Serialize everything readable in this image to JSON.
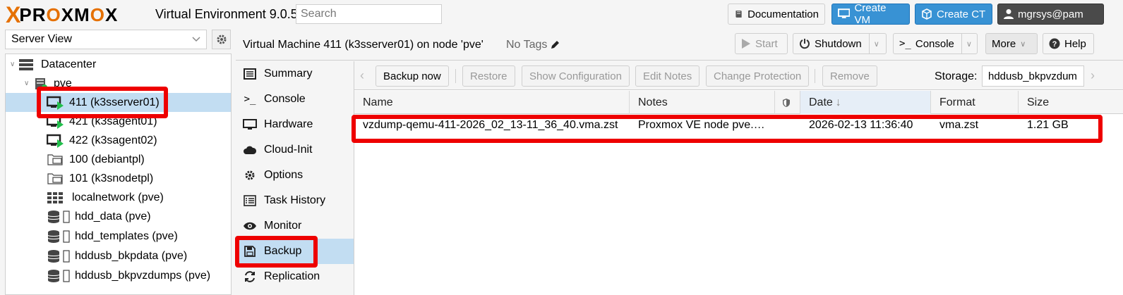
{
  "header": {
    "logo_text": "PROXMOX",
    "product": "Virtual Environment 9.0.5",
    "search_placeholder": "Search",
    "documentation_label": "Documentation",
    "create_vm_label": "Create VM",
    "create_ct_label": "Create CT",
    "user_label": "mgrsys@pam"
  },
  "left": {
    "view_select": "Server View",
    "tree": [
      {
        "label": "Datacenter",
        "icon": "datacenter-icon"
      },
      {
        "label": "pve",
        "icon": "node-icon"
      },
      {
        "label": "411 (k3sserver01)",
        "icon": "vm-running-icon",
        "selected": true
      },
      {
        "label": "421 (k3sagent01)",
        "icon": "vm-running-icon"
      },
      {
        "label": "422 (k3sagent02)",
        "icon": "vm-running-icon"
      },
      {
        "label": "100 (debiantpl)",
        "icon": "template-icon"
      },
      {
        "label": "101 (k3snodetpl)",
        "icon": "template-icon"
      },
      {
        "label": "localnetwork (pve)",
        "icon": "network-icon"
      },
      {
        "label": "hdd_data (pve)",
        "icon": "storage-icon"
      },
      {
        "label": "hdd_templates (pve)",
        "icon": "storage-icon"
      },
      {
        "label": "hddusb_bkpdata (pve)",
        "icon": "storage-icon"
      },
      {
        "label": "hddusb_bkpvzdumps (pve)",
        "icon": "storage-icon"
      }
    ]
  },
  "content": {
    "title": "Virtual Machine 411 (k3sserver01) on node 'pve'",
    "tags": "No Tags",
    "buttons": {
      "start": "Start",
      "shutdown": "Shutdown",
      "console": "Console",
      "more": "More",
      "help": "Help"
    },
    "nav": [
      {
        "label": "Summary",
        "icon": "summary-icon"
      },
      {
        "label": "Console",
        "icon": "console-icon"
      },
      {
        "label": "Hardware",
        "icon": "hardware-icon"
      },
      {
        "label": "Cloud-Init",
        "icon": "cloud-icon"
      },
      {
        "label": "Options",
        "icon": "options-gear-icon"
      },
      {
        "label": "Task History",
        "icon": "task-history-icon"
      },
      {
        "label": "Monitor",
        "icon": "monitor-eye-icon"
      },
      {
        "label": "Backup",
        "icon": "floppy-icon",
        "selected": true
      },
      {
        "label": "Replication",
        "icon": "replication-icon"
      }
    ],
    "backup": {
      "toolbar": {
        "backup_now": "Backup now",
        "restore": "Restore",
        "show_config": "Show Configuration",
        "edit_notes": "Edit Notes",
        "change_protection": "Change Protection",
        "remove": "Remove",
        "storage_label": "Storage:",
        "storage_value": "hddusb_bkpvzdum"
      },
      "columns": [
        "Name",
        "Notes",
        "Date",
        "Format",
        "Size"
      ],
      "rows": [
        {
          "name": "vzdump-qemu-411-2026_02_13-11_36_40.vma.zst",
          "notes": "Proxmox VE node pve.…",
          "date": "2026-02-13 11:36:40",
          "format": "vma.zst",
          "size": "1.21 GB"
        }
      ]
    }
  },
  "colors": {
    "accent": "#3892d4",
    "selection": "#c2ddf2",
    "logo_orange": "#e57000",
    "highlight_red": "#ee0000"
  }
}
